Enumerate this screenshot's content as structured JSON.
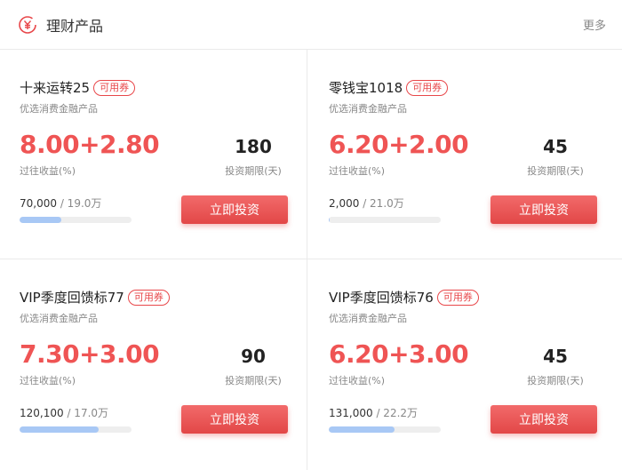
{
  "header": {
    "title": "理财产品",
    "more": "更多",
    "icon": "yuan-coin-icon"
  },
  "products": [
    {
      "name": "十来运转25",
      "coupon": "可用券",
      "desc": "优选消费金融产品",
      "rate": "8.00+2.80",
      "rate_label": "过往收益(%)",
      "term": "180",
      "term_label": "投资期限(天)",
      "amount": "70,000",
      "total": "/ 19.0万",
      "progress": 0.37,
      "button": "立即投资"
    },
    {
      "name": "零钱宝1018",
      "coupon": "可用券",
      "desc": "优选消费金融产品",
      "rate": "6.20+2.00",
      "rate_label": "过往收益(%)",
      "term": "45",
      "term_label": "投资期限(天)",
      "amount": "2,000",
      "total": "/ 21.0万",
      "progress": 0.01,
      "button": "立即投资"
    },
    {
      "name": "VIP季度回馈标77",
      "coupon": "可用券",
      "desc": "优选消费金融产品",
      "rate": "7.30+3.00",
      "rate_label": "过往收益(%)",
      "term": "90",
      "term_label": "投资期限(天)",
      "amount": "120,100",
      "total": "/ 17.0万",
      "progress": 0.71,
      "button": "立即投资"
    },
    {
      "name": "VIP季度回馈标76",
      "coupon": "可用券",
      "desc": "优选消费金融产品",
      "rate": "6.20+3.00",
      "rate_label": "过往收益(%)",
      "term": "45",
      "term_label": "投资期限(天)",
      "amount": "131,000",
      "total": "/ 22.2万",
      "progress": 0.59,
      "button": "立即投资"
    }
  ],
  "colors": {
    "accent": "#ef5454",
    "button": "#e24747",
    "progress": "#a8c8f5"
  }
}
